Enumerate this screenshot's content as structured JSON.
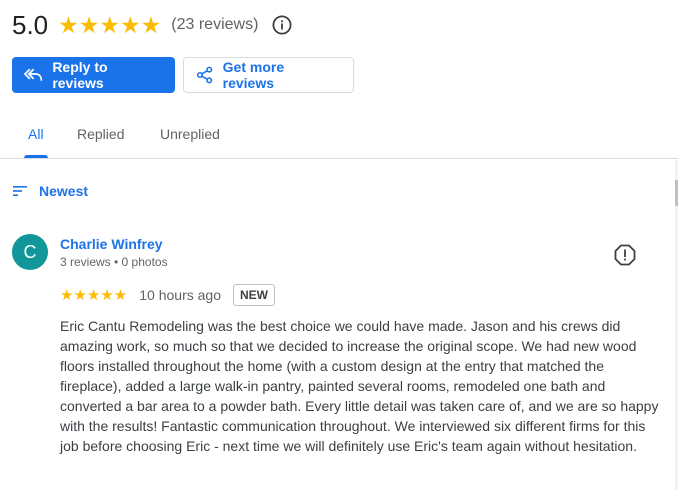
{
  "summary": {
    "rating": "5.0",
    "stars": "★★★★★",
    "review_count": "(23 reviews)"
  },
  "actions": {
    "reply_label": "Reply to reviews",
    "get_more_label": "Get more reviews"
  },
  "tabs": [
    {
      "label": "All",
      "active": true
    },
    {
      "label": "Replied",
      "active": false
    },
    {
      "label": "Unreplied",
      "active": false
    }
  ],
  "sort": {
    "label": "Newest"
  },
  "review": {
    "avatar_letter": "C",
    "avatar_color": "#11979a",
    "name": "Charlie Winfrey",
    "meta": "3 reviews • 0 photos",
    "stars": "★★★★★",
    "time": "10 hours ago",
    "badge": "NEW",
    "text": "Eric Cantu Remodeling was the best choice we could have made. Jason and his crews did amazing work, so much so that we decided to increase the original scope. We had new wood floors installed throughout the home (with a custom design at the entry that matched the fireplace), added a large walk-in pantry, painted several rooms, remodeled one bath and converted a bar area to a powder bath. Every little detail was taken care of, and we are so happy with the results! Fantastic communication throughout. We interviewed six different firms for this job before choosing Eric - next time we will definitely use Eric's team again without hesitation."
  },
  "colors": {
    "accent": "#1a73e8",
    "star": "#fbbc04"
  }
}
